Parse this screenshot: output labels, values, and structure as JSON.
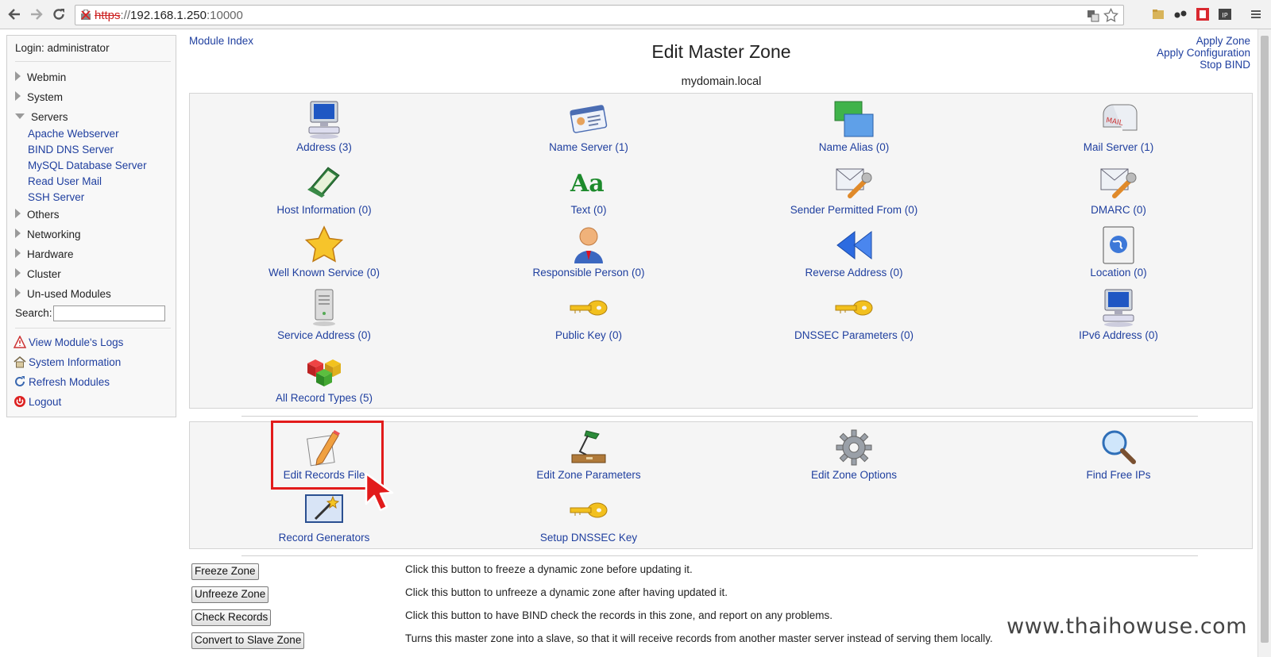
{
  "browser": {
    "url_scheme": "https",
    "url_sep": "://",
    "url_host": "192.168.1.250",
    "url_port": ":10000"
  },
  "sidebar": {
    "login": "Login: administrator",
    "categories": {
      "webmin": "Webmin",
      "system": "System",
      "servers": "Servers",
      "others": "Others",
      "networking": "Networking",
      "hardware": "Hardware",
      "cluster": "Cluster",
      "unused": "Un-used Modules"
    },
    "servers_items": [
      "Apache Webserver",
      "BIND DNS Server",
      "MySQL Database Server",
      "Read User Mail",
      "SSH Server"
    ],
    "search_label": "Search:",
    "actions": [
      "View Module's Logs",
      "System Information",
      "Refresh Modules",
      "Logout"
    ]
  },
  "header": {
    "module_index": "Module Index",
    "title": "Edit Master Zone",
    "zone": "mydomain.local",
    "apply_zone": "Apply Zone",
    "apply_config": "Apply Configuration",
    "stop_bind": "Stop BIND"
  },
  "records": [
    "Address (3)",
    "Name Server (1)",
    "Name Alias (0)",
    "Mail Server (1)",
    "Host Information (0)",
    "Text (0)",
    "Sender Permitted From (0)",
    "DMARC (0)",
    "Well Known Service (0)",
    "Responsible Person (0)",
    "Reverse Address (0)",
    "Location (0)",
    "Service Address (0)",
    "Public Key (0)",
    "DNSSEC Parameters (0)",
    "IPv6 Address (0)",
    "All Record Types (5)"
  ],
  "tools": [
    "Edit Records File",
    "Edit Zone Parameters",
    "Edit Zone Options",
    "Find Free IPs",
    "Record Generators",
    "Setup DNSSEC Key"
  ],
  "actions": [
    {
      "button": "Freeze Zone",
      "desc": "Click this button to freeze a dynamic zone before updating it."
    },
    {
      "button": "Unfreeze Zone",
      "desc": "Click this button to unfreeze a dynamic zone after having updated it."
    },
    {
      "button": "Check Records",
      "desc": "Click this button to have BIND check the records in this zone, and report on any problems."
    },
    {
      "button": "Convert to Slave Zone",
      "desc": "Turns this master zone into a slave, so that it will receive records from another master server instead of serving them locally."
    }
  ],
  "watermark": "www.thaihowuse.com",
  "colors": {
    "link": "#1f3f9f",
    "highlight": "#e21b1b"
  }
}
